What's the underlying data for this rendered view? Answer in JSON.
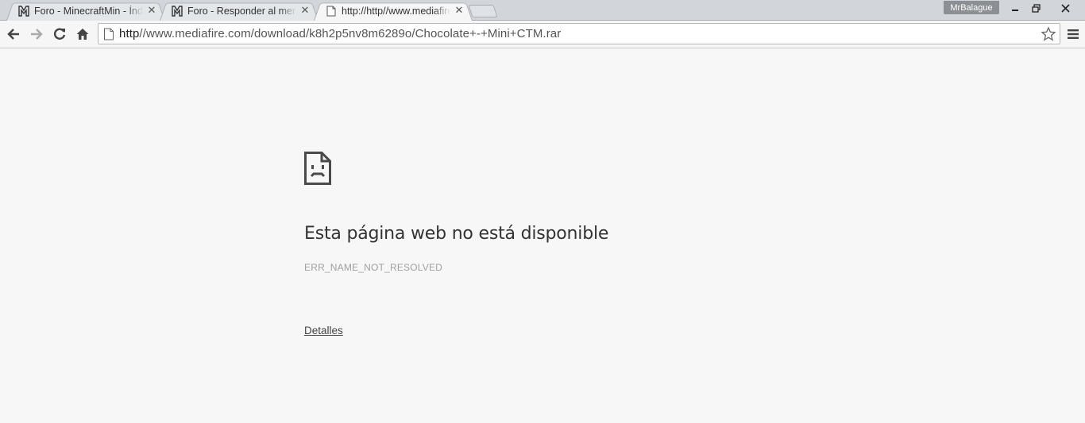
{
  "tabs": [
    {
      "title": "Foro - MinecraftMin - Índice",
      "icon": "minecraftmin-favicon",
      "active": false
    },
    {
      "title": "Foro - Responder al mensaje",
      "icon": "minecraftmin-favicon",
      "active": false
    },
    {
      "title": "http://http//www.mediafire.com",
      "icon": "page-icon",
      "active": true
    }
  ],
  "profile": {
    "name": "MrBalague"
  },
  "window_controls": {
    "minimize": "minimize-icon",
    "restore": "restore-icon",
    "close": "close-icon"
  },
  "omnibox": {
    "url_scheme": "http",
    "url_rest": "//www.mediafire.com/download/k8h2p5nv8m6289o/Chocolate+-+Mini+CTM.rar"
  },
  "error": {
    "title": "Esta página web no está disponible",
    "code": "ERR_NAME_NOT_RESOLVED",
    "details_label": "Detalles"
  },
  "colors": {
    "page_background": "#f7f7f7",
    "tabstrip": "#d2d6db",
    "active_tab": "#f6f6f6",
    "profile_badge": "#8c8f93"
  }
}
